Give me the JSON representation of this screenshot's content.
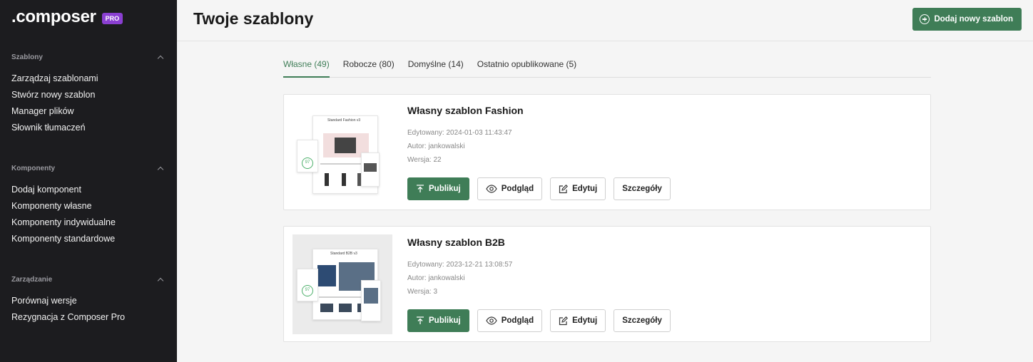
{
  "brand": {
    "name": ".composer",
    "badge": "PRO"
  },
  "sidebar": {
    "sections": [
      {
        "title": "Szablony",
        "items": [
          "Zarządzaj szablonami",
          "Stwórz nowy szablon",
          "Manager plików",
          "Słownik tłumaczeń"
        ]
      },
      {
        "title": "Komponenty",
        "items": [
          "Dodaj komponent",
          "Komponenty własne",
          "Komponenty indywidualne",
          "Komponenty standardowe"
        ]
      },
      {
        "title": "Zarządzanie",
        "items": [
          "Porównaj wersje",
          "Rezygnacja z Composer Pro"
        ]
      }
    ]
  },
  "header": {
    "title": "Twoje szablony",
    "add_button": "Dodaj nowy szablon"
  },
  "tabs": [
    {
      "label": "Własne (49)",
      "active": true
    },
    {
      "label": "Robocze (80)",
      "active": false
    },
    {
      "label": "Domyślne (14)",
      "active": false
    },
    {
      "label": "Ostatnio opublikowane (5)",
      "active": false
    }
  ],
  "templates": [
    {
      "title": "Własny szablon Fashion",
      "edited": "Edytowany: 2024-01-03 11:43:47",
      "author": "Autor: jankowalski",
      "version": "Wersja: 22",
      "thumb_title": "Standard Fashion v3",
      "score": "97"
    },
    {
      "title": "Własny szablon B2B",
      "edited": "Edytowany: 2023-12-21 13:08:57",
      "author": "Autor: jankowalski",
      "version": "Wersja: 3",
      "thumb_title": "Standard B2B v3",
      "score": "97"
    }
  ],
  "actions": {
    "publish": "Publikuj",
    "preview": "Podgląd",
    "edit": "Edytuj",
    "details": "Szczegóły"
  },
  "colors": {
    "accent": "#3f7d57",
    "sidebar": "#1c1c1f",
    "badge": "#8a3fd1"
  }
}
